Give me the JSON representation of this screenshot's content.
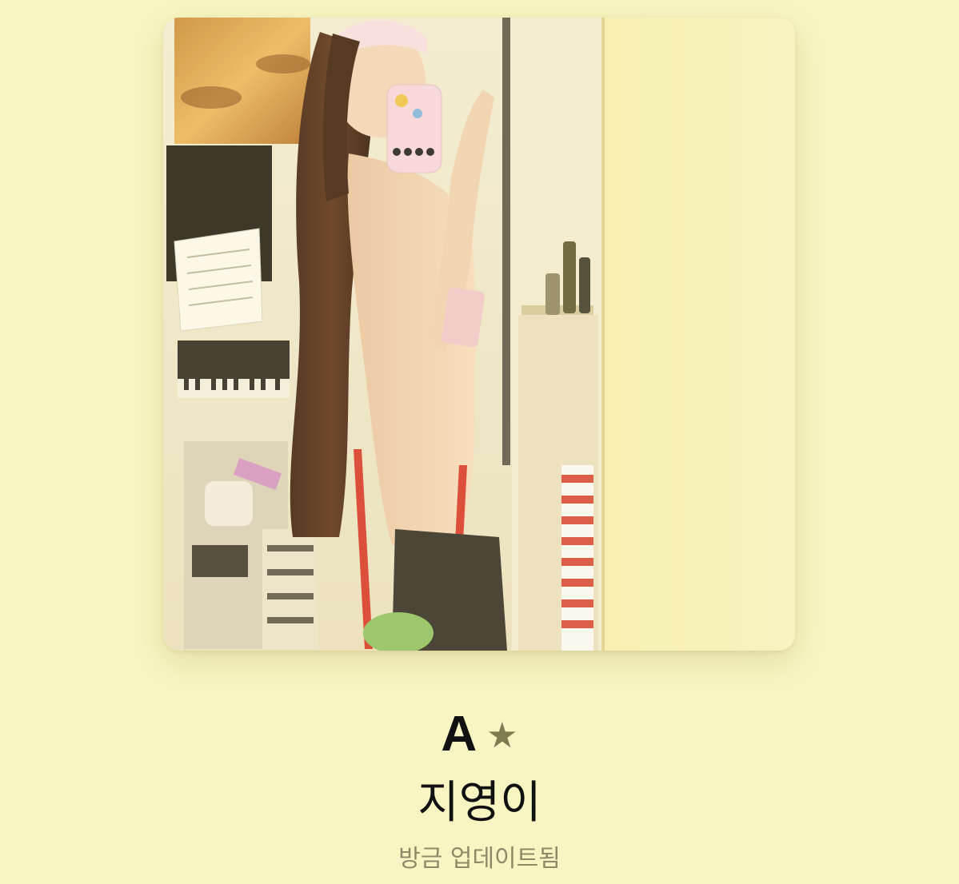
{
  "album": {
    "title": "A",
    "title_icon": "star-icon",
    "title_glyph": "★",
    "artist": "지영이",
    "status": "방금 업데이트됨",
    "cover_image": "mirror-selfie-photo"
  },
  "colors": {
    "background": "#f8f5c2",
    "title": "#111111",
    "star": "#7c7c4e",
    "status": "#8d8a6a"
  }
}
